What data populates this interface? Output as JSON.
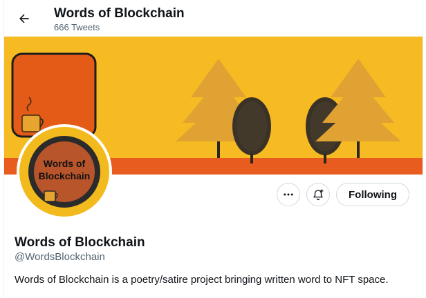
{
  "header": {
    "title": "Words of Blockchain",
    "tweet_count": "666 Tweets",
    "back_icon": "arrow-left-icon"
  },
  "banner": {
    "colors": {
      "sky": "#f5b717",
      "ground": "#e85d1f",
      "orange_panel": "#e45a17",
      "tree_dark": "#3a3226",
      "tree_light": "#e0a233"
    }
  },
  "avatar": {
    "line1": "Words of",
    "line2": "Blockchain",
    "colors": {
      "ring_outer": "#f3ba1e",
      "ring_dark": "#2b2b2b",
      "inner": "#b9552a"
    }
  },
  "actions": {
    "more_icon": "more-options-icon",
    "notify_icon": "bell-add-icon",
    "follow_label": "Following"
  },
  "profile": {
    "name": "Words of Blockchain",
    "handle": "@WordsBlockchain",
    "bio": "Words of Blockchain is a poetry/satire project bringing written word to NFT space."
  }
}
